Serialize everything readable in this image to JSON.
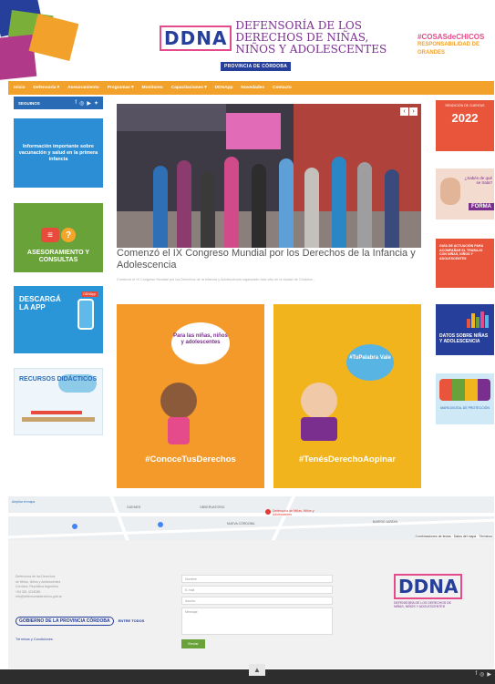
{
  "header": {
    "logo_text": "DDNA",
    "title": "DEFENSORÍA DE LOS DERECHOS DE NIÑAS, NIÑOS Y ADOLESCENTES",
    "province_tag": "PROVINCIA DE CÓRDOBA",
    "campaign": "#COSASdeCHICOS",
    "campaign_sub": "RESPONSABILIDAD DE GRANDES"
  },
  "nav": {
    "items": [
      "Inicio",
      "Defensoría ▾",
      "Asesoramiento",
      "Programas ▾",
      "Monitoreo",
      "Capacitaciones ▾",
      "DDNApp",
      "Novedades",
      "Contacto"
    ]
  },
  "sidebar_left": {
    "social_label": "SEGUINOS",
    "cards": {
      "info": "Información importante sobre vacunación y salud en la primera infancia",
      "asesoramiento": "ASESORAMIENTO Y CONSULTAS",
      "app": "DESCARGÁ LA APP",
      "app_badge": "DDNApp",
      "recursos": "RECURSOS DIDÁCTICOS"
    }
  },
  "main": {
    "news_title": "Comenzó el IX Congreso Mundial por los Derechos de la Infancia y Adolescencia",
    "news_excerpt": "Comenzó el IX Congreso Mundial por los Derechos de la Infancia y Adolescencia organizado este año en la ciudad de Córdoba...",
    "promo_left": {
      "bubble": "Para las niñas, niños y adolescentes",
      "hashtag": "#ConoceTusDerechos"
    },
    "promo_right": {
      "bubble": "#TuPalabra Vale",
      "hashtag": "#TenésDerechoAopinar"
    }
  },
  "sidebar_right": {
    "card1_label": "RENDICIÓN DE CUENTAS",
    "card1_year": "2022",
    "card2_label": "¿Sabés de qué se trata?",
    "card2_tag": "FORMA",
    "card3_label": "GUÍA DE ACTUACIÓN PARA ACOMPAÑAR EL TRABAJO CON NIÑAS, NIÑOS Y ADOLESCENTES",
    "card4_label": "DATOS SOBRE NIÑAS Y ADOLESCENCIA",
    "card5_label": "MAPA DIGITAL DE PROTECCIÓN"
  },
  "map": {
    "labels": [
      "Ampliar el mapa",
      "GUEMES",
      "OBSERVATORIO",
      "BARRIO JARDIN",
      "NUEVA CÓRDOBA",
      "Defensoría de Niñas, Niños y Adolescentes",
      "Combinaciones de teclas · Datos del mapa · Términos"
    ]
  },
  "footer": {
    "contact_lines": [
      "Defensoría de los Derechos",
      "de Niñas, Niños y Adolescentes",
      "Córdoba, República Argentina",
      "+54 351 4218080",
      "info@defensoriaderechos.gob.ar"
    ],
    "cba_logo": "GOBIERNO DE LA PROVINCIA CÓRDOBA",
    "cba_logo_sub": "ENTRE TODOS",
    "terms": "Términos y Condiciones",
    "form": {
      "name_placeholder": "Nombre",
      "email_placeholder": "E-mail",
      "subject_placeholder": "Asunto",
      "message_placeholder": "Mensaje",
      "send_label": "Enviar"
    },
    "logo_text": "DDNA",
    "logo_sub": "DEFENSORÍA DE LOS DERECHOS DE NIÑAS, NIÑOS Y ADOLESCENTES"
  },
  "bottom": {
    "scroll_top": "▲"
  }
}
